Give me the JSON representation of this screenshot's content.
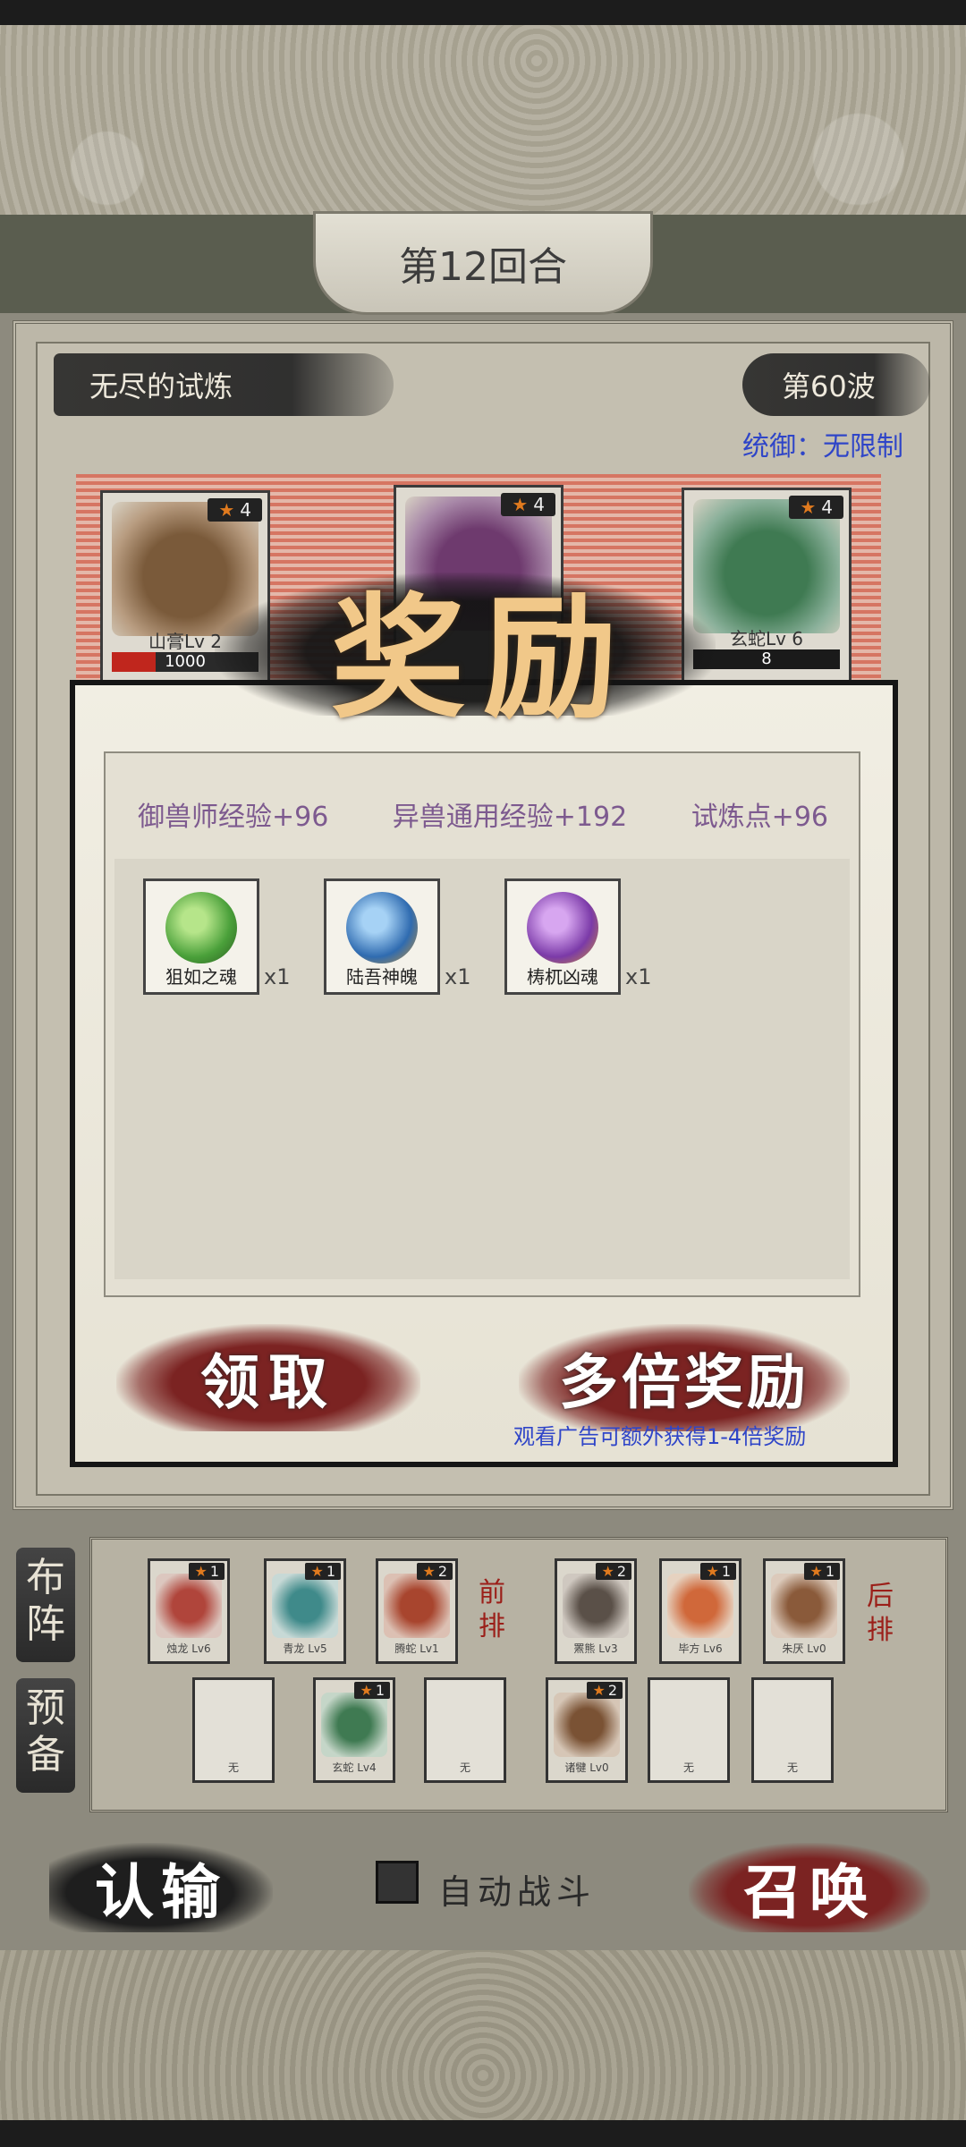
{
  "header": {
    "round_title": "第12回合"
  },
  "info": {
    "trial_name": "无尽的试炼",
    "wave": "第60波",
    "command": "统御：无限制"
  },
  "enemies": [
    {
      "name": "山膏Lv 2",
      "stars": "4",
      "hp": "1000",
      "color": "#7a5a3a"
    },
    {
      "name": "",
      "stars": "4",
      "hp": "",
      "color": "#6e3a6e"
    },
    {
      "name": "玄蛇Lv 6",
      "stars": "4",
      "hp": "8",
      "color": "#3f7a52"
    }
  ],
  "reward": {
    "title": "奖励",
    "stats": [
      "御兽师经验+96",
      "异兽通用经验+192",
      "试炼点+96"
    ],
    "items": [
      {
        "name": "狙如之魂",
        "qty": "x1",
        "color": "#4aa03a"
      },
      {
        "name": "陆吾神魄",
        "qty": "x1",
        "color": "#2f6bb0"
      },
      {
        "name": "梼杌凶魂",
        "qty": "x1",
        "color": "#7b3aa8"
      }
    ],
    "claim_label": "领取",
    "multi_label": "多倍奖励",
    "ad_hint": "观看广告可额外获得1-4倍奖励"
  },
  "lineup": {
    "tab_lineup": "布阵",
    "tab_reserve": "预备",
    "front_label": "前排",
    "back_label": "后排",
    "front": [
      {
        "name": "烛龙 Lv6",
        "stars": "1",
        "color": "#b0453b"
      },
      {
        "name": "青龙 Lv5",
        "stars": "1",
        "color": "#3f8a8a"
      },
      {
        "name": "腾蛇 Lv1",
        "stars": "2",
        "color": "#a8452e"
      }
    ],
    "back": [
      {
        "name": "罴熊 Lv3",
        "stars": "2",
        "color": "#5a5048"
      },
      {
        "name": "毕方 Lv6",
        "stars": "1",
        "color": "#d0683a"
      },
      {
        "name": "朱厌 Lv0",
        "stars": "1",
        "color": "#8a5a3a"
      }
    ],
    "reserve": [
      {
        "name": "无",
        "stars": "",
        "color": ""
      },
      {
        "name": "玄蛇 Lv4",
        "stars": "1",
        "color": "#3f7a52"
      },
      {
        "name": "无",
        "stars": "",
        "color": ""
      },
      {
        "name": "诸犍 Lv0",
        "stars": "2",
        "color": "#7a5234"
      },
      {
        "name": "无",
        "stars": "",
        "color": ""
      },
      {
        "name": "无",
        "stars": "",
        "color": ""
      }
    ]
  },
  "footer": {
    "surrender_label": "认输",
    "auto_label": "自动战斗",
    "summon_label": "召唤"
  }
}
